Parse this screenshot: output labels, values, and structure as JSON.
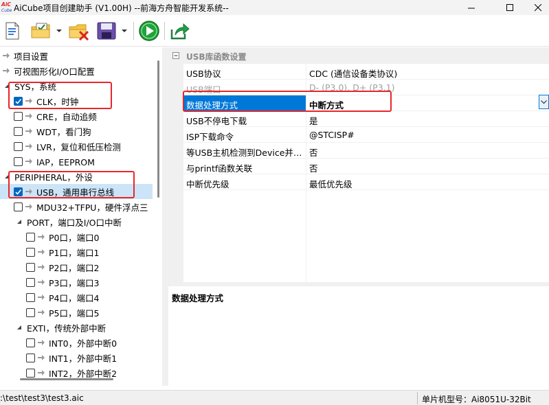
{
  "window": {
    "logo_text_top": "AiC",
    "logo_text_bottom": "Cube",
    "title": "AiCube项目创建助手 (V1.00H) --前海方舟智能开发系统--"
  },
  "toolbar": {
    "buttons": [
      "new-project",
      "open-project",
      "close-project",
      "save-project",
      "run",
      "export"
    ]
  },
  "tree": {
    "items": [
      {
        "label": "项目设置",
        "type": "arrow"
      },
      {
        "label": "可视图形化I/O口配置",
        "type": "arrow"
      },
      {
        "label": "SYS，系统",
        "type": "group"
      },
      {
        "label": "CLK，时钟",
        "type": "check",
        "checked": true
      },
      {
        "label": "CRE，自动追频",
        "type": "check",
        "checked": false
      },
      {
        "label": "WDT，看门狗",
        "type": "check",
        "checked": false
      },
      {
        "label": "LVR，复位和低压检测",
        "type": "check",
        "checked": false
      },
      {
        "label": "IAP，EEPROM",
        "type": "check",
        "checked": false
      },
      {
        "label": "PERIPHERAL，外设",
        "type": "group"
      },
      {
        "label": "USB，通用串行总线",
        "type": "check",
        "checked": true,
        "selected": true
      },
      {
        "label": "MDU32+TFPU，硬件浮点三",
        "type": "check",
        "checked": false
      },
      {
        "label": "PORT，端口及I/O口中断",
        "type": "subgroup"
      },
      {
        "label": "P0口，端口0",
        "type": "subcheck",
        "checked": false
      },
      {
        "label": "P1口，端口1",
        "type": "subcheck",
        "checked": false
      },
      {
        "label": "P2口，端口2",
        "type": "subcheck",
        "checked": false
      },
      {
        "label": "P3口，端口3",
        "type": "subcheck",
        "checked": false
      },
      {
        "label": "P4口，端口4",
        "type": "subcheck",
        "checked": false
      },
      {
        "label": "P5口，端口5",
        "type": "subcheck",
        "checked": false
      },
      {
        "label": "EXTI，传统外部中断",
        "type": "subgroup"
      },
      {
        "label": "INT0，外部中断0",
        "type": "subcheck",
        "checked": false
      },
      {
        "label": "INT1，外部中断1",
        "type": "subcheck",
        "checked": false
      },
      {
        "label": "INT2，外部中断2",
        "type": "subcheck",
        "checked": false
      }
    ]
  },
  "properties": {
    "category": "USB库函数设置",
    "rows": [
      {
        "name": "USB协议",
        "value": "CDC (通信设备类协议)"
      },
      {
        "name": "USB端口",
        "value": "D- (P3.0), D+ (P3.1)",
        "disabled": true
      },
      {
        "name": "数据处理方式",
        "value": "中断方式",
        "selected": true
      },
      {
        "name": "USB不停电下载",
        "value": "是"
      },
      {
        "name": "ISP下载命令",
        "value": "@STCISP#"
      },
      {
        "name": "等USB主机检测到Device并…",
        "value": "否"
      },
      {
        "name": "与printf函数关联",
        "value": "否"
      },
      {
        "name": "中断优先级",
        "value": "最低优先级"
      }
    ],
    "description_title": "数据处理方式"
  },
  "status": {
    "path": ":\\test\\test3\\test3.aic",
    "chip": "单片机型号：Ai8051U-32Bit"
  },
  "colors": {
    "accent": "#0078d7",
    "annotation": "#e8262a",
    "tree_selected": "#cce4f7"
  }
}
